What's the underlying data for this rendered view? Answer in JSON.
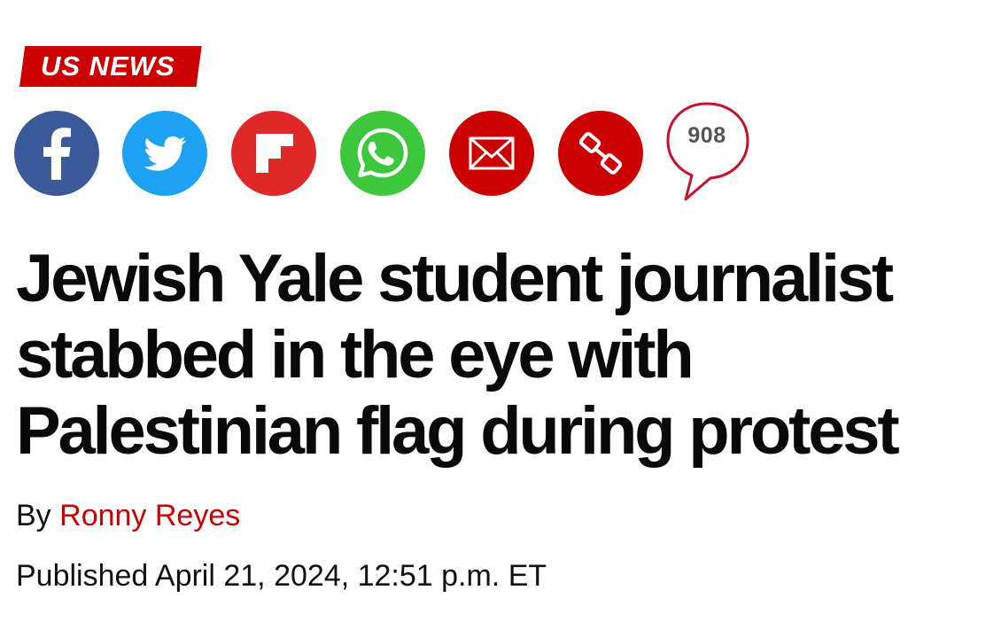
{
  "section": {
    "label": "US NEWS",
    "color": "#cc0000"
  },
  "share": {
    "buttons": [
      {
        "name": "facebook",
        "icon": "facebook-icon",
        "color": "#3b5998"
      },
      {
        "name": "twitter",
        "icon": "twitter-bird-icon",
        "color": "#1da1f2"
      },
      {
        "name": "flipboard",
        "icon": "flipboard-icon",
        "color": "#e12828"
      },
      {
        "name": "whatsapp",
        "icon": "whatsapp-icon",
        "color": "#3dc73d"
      },
      {
        "name": "email",
        "icon": "envelope-icon",
        "color": "#cc0000"
      },
      {
        "name": "copy-link",
        "icon": "link-icon",
        "color": "#cc0000"
      }
    ],
    "comments_count": "908"
  },
  "article": {
    "headline_lines": [
      "Jewish Yale student journalist",
      "stabbed in the eye with",
      "Palestinian flag during protest"
    ],
    "byline_prefix": "By",
    "author": "Ronny Reyes",
    "author_color": "#cc0000",
    "published": "Published April 21, 2024, 12:51 p.m. ET"
  }
}
